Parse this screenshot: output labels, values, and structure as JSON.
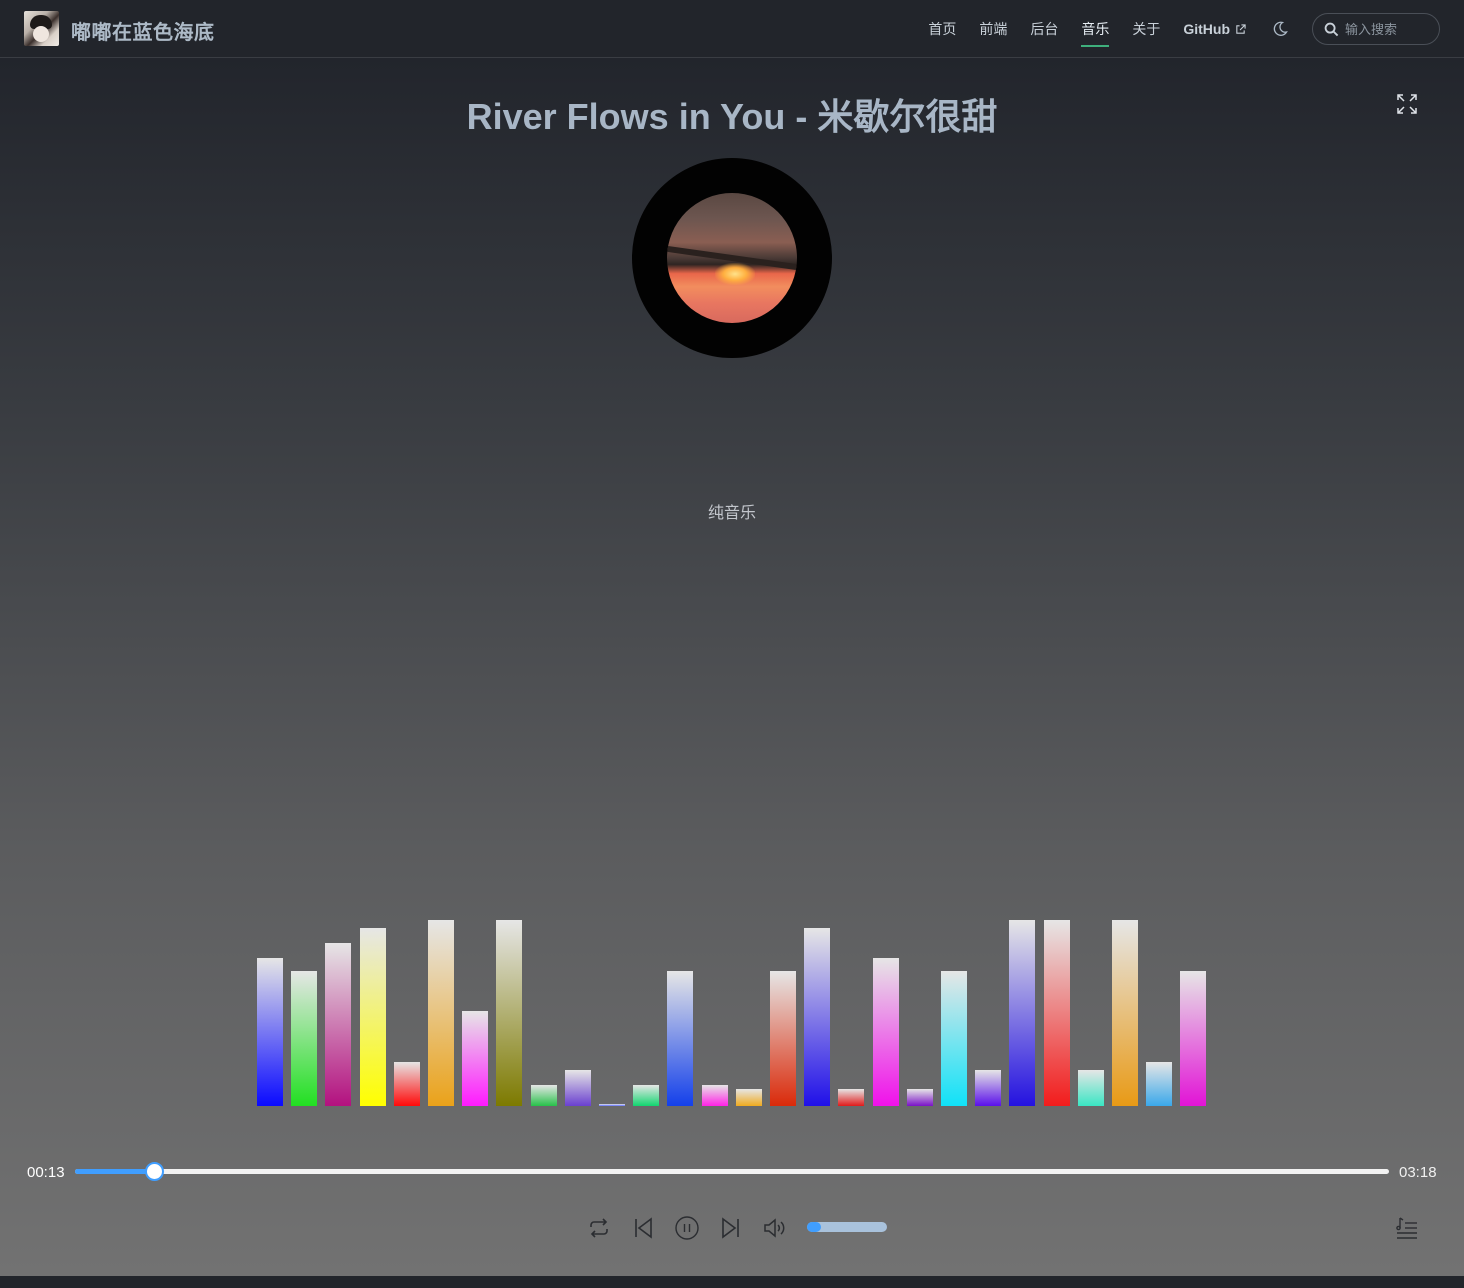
{
  "site": {
    "title": "嘟嘟在蓝色海底",
    "logo": "avatar"
  },
  "nav": {
    "items": [
      {
        "label": "首页",
        "active": false
      },
      {
        "label": "前端",
        "active": false
      },
      {
        "label": "后台",
        "active": false
      },
      {
        "label": "音乐",
        "active": true
      },
      {
        "label": "关于",
        "active": false
      }
    ],
    "github_label": "GitHub",
    "github_icon": "external-link-icon",
    "theme_icon": "moon-icon",
    "search_placeholder": "输入搜索",
    "search_value": ""
  },
  "player": {
    "song_title": "River Flows in You - 米歇尔很甜",
    "lyric": "纯音乐",
    "current_time": "00:13",
    "total_time": "03:18",
    "progress": 0.06,
    "volume": 0.18,
    "state": "playing",
    "controls": [
      "repeat-icon",
      "previous-icon",
      "pause-icon",
      "next-icon",
      "volume-icon",
      "playlist-icon"
    ]
  },
  "visualizer": {
    "max": 186,
    "bars": [
      {
        "value": 148,
        "color": "#0a0aff"
      },
      {
        "value": 135,
        "color": "#22e022"
      },
      {
        "value": 163,
        "color": "#b3117f"
      },
      {
        "value": 178,
        "color": "#ffff00"
      },
      {
        "value": 44,
        "color": "#ff0a0a"
      },
      {
        "value": 186,
        "color": "#eaa21a"
      },
      {
        "value": 95,
        "color": "#ff1aff"
      },
      {
        "value": 186,
        "color": "#7d7a00"
      },
      {
        "value": 21,
        "color": "#28c14a"
      },
      {
        "value": 36,
        "color": "#6a40d0"
      },
      {
        "value": 2,
        "color": "#5a6cff"
      },
      {
        "value": 21,
        "color": "#12d670"
      },
      {
        "value": 135,
        "color": "#1440ea"
      },
      {
        "value": 21,
        "color": "#ff22e6"
      },
      {
        "value": 17,
        "color": "#efaa1e"
      },
      {
        "value": 135,
        "color": "#da2a0a"
      },
      {
        "value": 178,
        "color": "#2010e8"
      },
      {
        "value": 17,
        "color": "#e01a1a"
      },
      {
        "value": 148,
        "color": "#f011ea"
      },
      {
        "value": 17,
        "color": "#7a12c8"
      },
      {
        "value": 135,
        "color": "#10e2f8"
      },
      {
        "value": 36,
        "color": "#5a10ea"
      },
      {
        "value": 186,
        "color": "#2412e0"
      },
      {
        "value": 186,
        "color": "#f21c1c"
      },
      {
        "value": 36,
        "color": "#3ae6c4"
      },
      {
        "value": 186,
        "color": "#e89a16"
      },
      {
        "value": 44,
        "color": "#3aa8ea"
      },
      {
        "value": 135,
        "color": "#e214d6"
      }
    ]
  }
}
